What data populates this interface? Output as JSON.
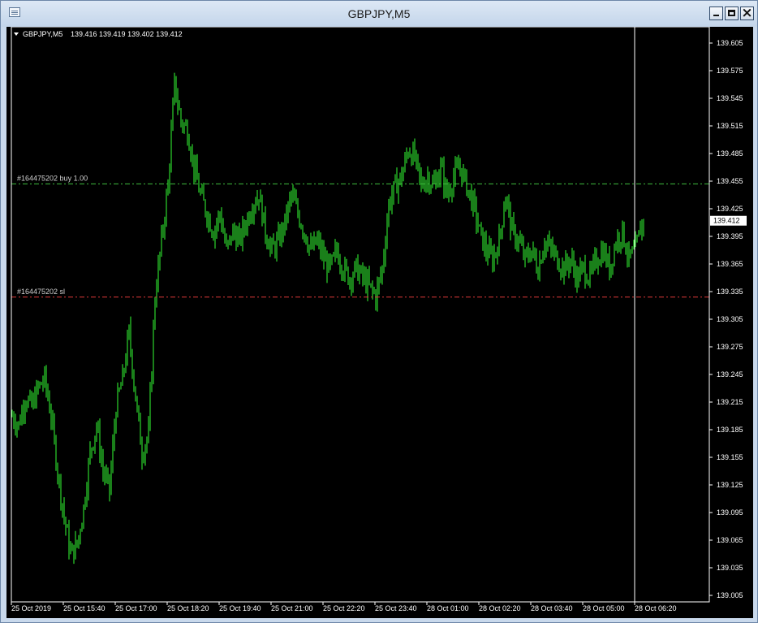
{
  "window": {
    "title": "GBPJPY,M5"
  },
  "chart_header": {
    "symbol": "GBPJPY,M5",
    "ohlc": "139.416 139.419 139.402 139.412"
  },
  "order_lines": [
    {
      "label": "#164475202 buy 1.00",
      "price": 139.452,
      "color": "#3fbf3f"
    },
    {
      "label": "#164475202 sl",
      "price": 139.329,
      "color": "#e03a3a"
    }
  ],
  "price_label": {
    "value": "139.412",
    "price": 139.412
  },
  "colors": {
    "background": "#000000",
    "candles": "#33ff33",
    "axis": "#ffffff",
    "grid_line": "#ffffff"
  },
  "chart_data": {
    "type": "candlestick",
    "symbol": "GBPJPY",
    "timeframe": "M5",
    "ylim": [
      139.0,
      139.61
    ],
    "y_ticks": [
      "139.605",
      "139.575",
      "139.545",
      "139.515",
      "139.485",
      "139.455",
      "139.425",
      "139.395",
      "139.365",
      "139.335",
      "139.305",
      "139.275",
      "139.245",
      "139.215",
      "139.185",
      "139.155",
      "139.125",
      "139.095",
      "139.065",
      "139.035",
      "139.005"
    ],
    "x_ticks": [
      "25 Oct 2019",
      "25 Oct 15:40",
      "25 Oct 17:00",
      "25 Oct 18:20",
      "25 Oct 19:40",
      "25 Oct 21:00",
      "25 Oct 22:20",
      "25 Oct 23:40",
      "28 Oct 01:00",
      "28 Oct 02:20",
      "28 Oct 03:40",
      "28 Oct 05:00",
      "28 Oct 06:20"
    ],
    "close_path": [
      [
        0,
        139.2
      ],
      [
        8,
        139.19
      ],
      [
        16,
        139.22
      ],
      [
        24,
        139.21
      ],
      [
        32,
        139.23
      ],
      [
        40,
        139.24
      ],
      [
        48,
        139.2
      ],
      [
        56,
        139.14
      ],
      [
        64,
        139.09
      ],
      [
        72,
        139.05
      ],
      [
        80,
        139.06
      ],
      [
        88,
        139.1
      ],
      [
        96,
        139.16
      ],
      [
        104,
        139.19
      ],
      [
        112,
        139.14
      ],
      [
        120,
        139.12
      ],
      [
        128,
        139.21
      ],
      [
        136,
        139.24
      ],
      [
        144,
        139.29
      ],
      [
        152,
        139.22
      ],
      [
        160,
        139.16
      ],
      [
        168,
        139.18
      ],
      [
        176,
        139.33
      ],
      [
        184,
        139.39
      ],
      [
        192,
        139.45
      ],
      [
        200,
        139.56
      ],
      [
        208,
        139.52
      ],
      [
        216,
        139.51
      ],
      [
        224,
        139.47
      ],
      [
        232,
        139.44
      ],
      [
        240,
        139.42
      ],
      [
        248,
        139.4
      ],
      [
        256,
        139.42
      ],
      [
        264,
        139.38
      ],
      [
        272,
        139.4
      ],
      [
        280,
        139.39
      ],
      [
        288,
        139.41
      ],
      [
        296,
        139.43
      ],
      [
        304,
        139.44
      ],
      [
        312,
        139.4
      ],
      [
        320,
        139.38
      ],
      [
        328,
        139.39
      ],
      [
        336,
        139.41
      ],
      [
        344,
        139.44
      ],
      [
        352,
        139.42
      ],
      [
        360,
        139.4
      ],
      [
        368,
        139.38
      ],
      [
        376,
        139.39
      ],
      [
        384,
        139.37
      ],
      [
        392,
        139.36
      ],
      [
        400,
        139.38
      ],
      [
        408,
        139.36
      ],
      [
        416,
        139.35
      ],
      [
        424,
        139.36
      ],
      [
        432,
        139.35
      ],
      [
        440,
        139.34
      ],
      [
        448,
        139.33
      ],
      [
        456,
        139.36
      ],
      [
        464,
        139.43
      ],
      [
        472,
        139.45
      ],
      [
        480,
        139.46
      ],
      [
        488,
        139.49
      ],
      [
        496,
        139.48
      ],
      [
        504,
        139.45
      ],
      [
        512,
        139.46
      ],
      [
        520,
        139.45
      ],
      [
        528,
        139.47
      ],
      [
        536,
        139.44
      ],
      [
        544,
        139.46
      ],
      [
        552,
        139.47
      ],
      [
        560,
        139.45
      ],
      [
        568,
        139.43
      ],
      [
        576,
        139.4
      ],
      [
        584,
        139.38
      ],
      [
        592,
        139.37
      ],
      [
        600,
        139.39
      ],
      [
        608,
        139.44
      ],
      [
        616,
        139.4
      ],
      [
        624,
        139.39
      ],
      [
        632,
        139.37
      ],
      [
        640,
        139.38
      ],
      [
        648,
        139.36
      ],
      [
        656,
        139.39
      ],
      [
        664,
        139.38
      ],
      [
        672,
        139.37
      ],
      [
        680,
        139.36
      ],
      [
        688,
        139.37
      ],
      [
        696,
        139.35
      ],
      [
        704,
        139.36
      ],
      [
        712,
        139.35
      ],
      [
        720,
        139.37
      ],
      [
        728,
        139.38
      ],
      [
        736,
        139.36
      ],
      [
        744,
        139.39
      ],
      [
        752,
        139.4
      ],
      [
        760,
        139.37
      ],
      [
        768,
        139.38
      ],
      [
        776,
        139.41
      ],
      [
        780,
        139.412
      ]
    ]
  }
}
